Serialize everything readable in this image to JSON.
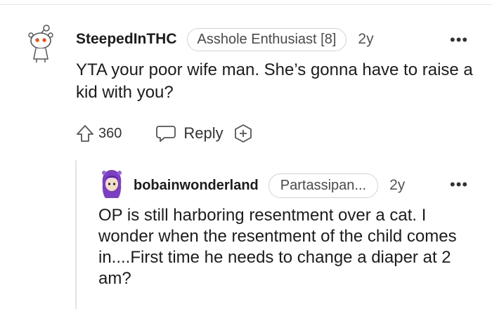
{
  "comment1": {
    "username": "SteepedInTHC",
    "flair": "Asshole Enthusiast [8]",
    "time": "2y",
    "more": "•••",
    "body": "YTA your poor wife man. She’s gonna have to raise a kid with you?",
    "upvotes": "360",
    "reply_label": "Reply",
    "avatar_icon": "snoo-avatar-icon"
  },
  "comment2": {
    "username": "bobainwonderland",
    "flair": "Partassipan...",
    "time": "2y",
    "more": "•••",
    "body": "OP is still harboring resentment over a cat. I wonder when the resentment of the child comes in....First time he needs to change a diaper at 2 am?",
    "avatar_icon": "purple-avatar-icon"
  },
  "colors": {
    "accent_red": "#ff4500",
    "avatar_purple": "#7b3fc4",
    "divider": "#e3e3e3"
  }
}
